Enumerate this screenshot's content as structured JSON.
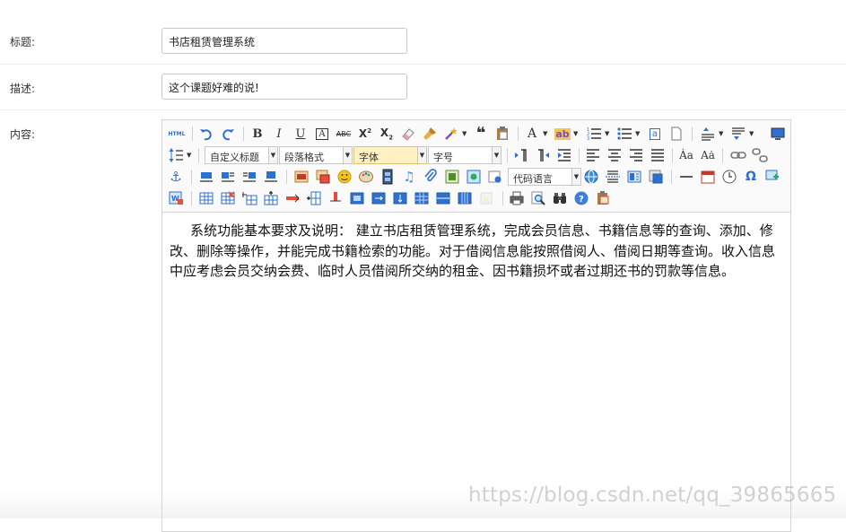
{
  "form": {
    "title_label": "标题:",
    "title_value": "书店租赁管理系统",
    "desc_label": "描述:",
    "desc_value": "这个课题好难的说!",
    "content_label": "内容:"
  },
  "toolbar": {
    "source_label": "HTML",
    "custom_title": "自定义标题",
    "paragraph": "段落格式",
    "font": "字体",
    "font_size": "字号",
    "code_lang": "代码语言"
  },
  "editor": {
    "content": "系统功能基本要求及说明： 建立书店租赁管理系统，完成会员信息、书籍信息等的查询、添加、修改、删除等操作，并能完成书籍检索的功能。对于借阅信息能按照借阅人、借阅日期等查询。收入信息中应考虑会员交纳会费、临时人员借阅所交纳的租金、因书籍损坏或者过期还书的罚款等信息。"
  },
  "watermark": "https://blog.csdn.net/qq_39865665",
  "colors": {
    "accent_blue": "#2f6fcf",
    "toolbar_bg": "#fafafa",
    "active_combo": "#fff1c4"
  }
}
